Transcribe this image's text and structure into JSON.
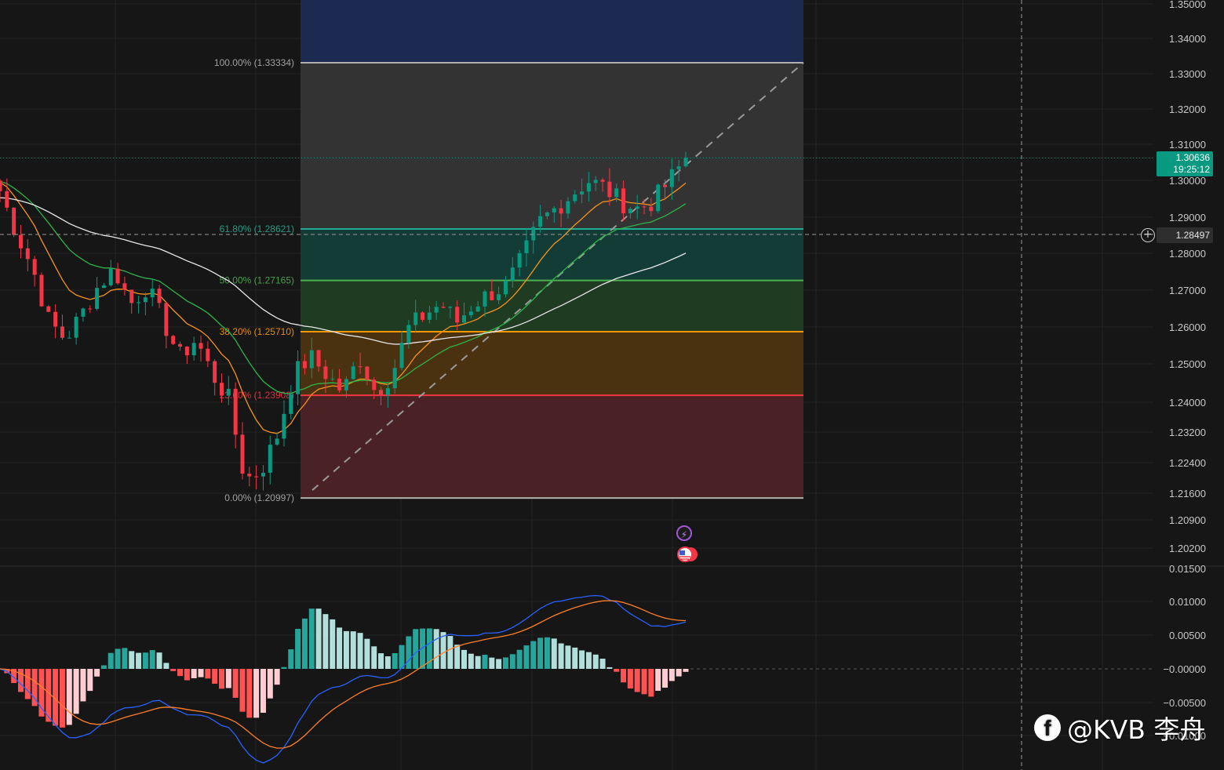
{
  "colors": {
    "background": "#161616",
    "up": "#089981",
    "down": "#f23645",
    "ema_fast": "#f7931a",
    "ema_mid": "#2db34a",
    "ema_slow": "#e8e8e8",
    "macd": "#2962ff",
    "signal": "#ff7f27",
    "hist_pos_strong": "#26a69a",
    "hist_pos_weak": "#b2dfdb",
    "hist_neg_strong": "#ff5252",
    "hist_neg_weak": "#ffcdd2"
  },
  "price_axis": {
    "labels": [
      "1.35000",
      "1.34000",
      "1.33000",
      "1.32000",
      "1.31000",
      "1.30000",
      "1.29000",
      "1.28000",
      "1.27000",
      "1.26000",
      "1.25000",
      "1.24000",
      "1.23200",
      "1.22400",
      "1.21600",
      "1.20900",
      "1.20200"
    ]
  },
  "macd_axis": {
    "labels": [
      "0.01500",
      "0.01000",
      "0.00500",
      "−0.00000",
      "−0.00500",
      "−0.01000"
    ]
  },
  "last_price": {
    "value": "1.30636",
    "countdown": "19:25:12"
  },
  "crosshair_price": "1.28497",
  "fib_levels": [
    {
      "label": "100.00% (1.33334)",
      "price": 1.33334,
      "color": "#b0b0b0"
    },
    {
      "label": "61.80% (1.28621)",
      "price": 1.28621,
      "color": "#22ab94"
    },
    {
      "label": "50.00% (1.27165)",
      "price": 1.27165,
      "color": "#4caf50"
    },
    {
      "label": "38.20% (1.25710)",
      "price": 1.2571,
      "color": "#ff9800"
    },
    {
      "label": "23.60% (1.23908)",
      "price": 1.23908,
      "color": "#f23645"
    },
    {
      "label": "0.00% (1.20997)",
      "price": 1.20997,
      "color": "#b0b0b0"
    }
  ],
  "watermark": {
    "brand": "f",
    "text": "@KVB 李舟"
  },
  "chart_data": {
    "type": "candlestick",
    "title": "",
    "y_range": [
      1.2,
      1.35
    ],
    "grid": true,
    "series": [
      {
        "name": "price",
        "note": "candles not individually labeled; approximate trajectory",
        "close_path": [
          1.297,
          1.285,
          1.275,
          1.26,
          1.255,
          1.262,
          1.27,
          1.275,
          1.265,
          1.27,
          1.26,
          1.25,
          1.255,
          1.245,
          1.238,
          1.215,
          1.218,
          1.228,
          1.245,
          1.25,
          1.245,
          1.24,
          1.25,
          1.24,
          1.245,
          1.258,
          1.262,
          1.265,
          1.26,
          1.265,
          1.268,
          1.27,
          1.278,
          1.288,
          1.292,
          1.296,
          1.3,
          1.298,
          1.294,
          1.292,
          1.294,
          1.3,
          1.306
        ]
      }
    ]
  }
}
